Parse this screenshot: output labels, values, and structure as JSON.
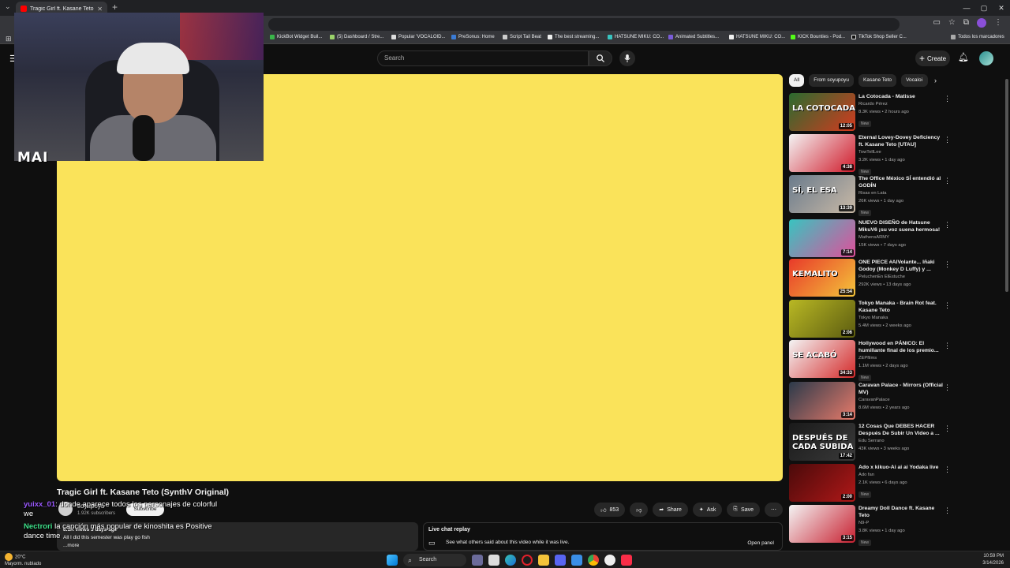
{
  "browser": {
    "tab_title": "Tragic Girl ft. Kasane Teto (SynthV",
    "bookmarks": [
      "KickBot Widget Buil...",
      "(5) Dashboard / Stre...",
      "Popular 'VOCALOID...",
      "PreSonus: Home",
      "Script Tail Beat",
      "The best streaming...",
      "HATSUNE MIKU: CO...",
      "Animated Subtitles...",
      "HATSUNE MIKU: CO...",
      "KICK Bounties - Pod...",
      "TikTok Shop Seller C..."
    ],
    "all_bookmarks": "Todos los marcadores"
  },
  "header": {
    "search_placeholder": "Search",
    "create_label": "Create"
  },
  "webcam": {
    "label": "MAI"
  },
  "video": {
    "title": "Tragic Girl ft. Kasane Teto (SynthV Original)",
    "channel": "soyupoyu",
    "subscribers": "1.92K subscribers",
    "subscribe_label": "Subscribe",
    "likes": "853",
    "share_label": "Share",
    "ask_label": "Ask",
    "save_label": "Save",
    "description_meta": "8.1K views  3 days ago",
    "description_line": "All I did this semester was play go fish",
    "more_label": "...more"
  },
  "live_chat": {
    "title": "Live chat replay",
    "subtitle": "See what others said about this video while it was live.",
    "open_panel": "Open panel"
  },
  "chat_overlay": [
    {
      "user": "yuixx_01",
      "message": ": donde aparece todos los personajes de colorful",
      "cont": "we"
    },
    {
      "user": "Nectrori",
      "message": "  la canción más popular de kinoshita es Positive",
      "cont": "dance time"
    }
  ],
  "chips": [
    "All",
    "From soyupoyu",
    "Kasane Teto",
    "Vocaloi"
  ],
  "recommendations": [
    {
      "title": "La Cotocada - Matisse",
      "channel": "Ricardo Pérez",
      "stats": "8.3K views • 2 hours ago",
      "badge": "New",
      "duration": "12:05",
      "thumb_text": "LA COTOCADA",
      "colors": [
        "#2a6b2f",
        "#d43a1f"
      ]
    },
    {
      "title": "Eternal Lovey-Dovey Deficiency ft. Kasane Teto [UTAU]",
      "channel": "TowTellLee",
      "stats": "3.2K views • 1 day ago",
      "badge": "New",
      "duration": "4:38",
      "thumb_text": "",
      "colors": [
        "#f4f4f4",
        "#d01a2a"
      ]
    },
    {
      "title": "The Office México SÍ entendió al GODÍN",
      "channel": "Risas en Lata",
      "stats": "26K views • 1 day ago",
      "badge": "New",
      "duration": "13:39",
      "thumb_text": "SÍ, EL ESA",
      "colors": [
        "#6a7b8c",
        "#c9b9a6"
      ]
    },
    {
      "title": "NUEVO DISEÑO de Hatsune MikuV6 ¡su voz suena hermosa!",
      "channel": "MathensARMY",
      "stats": "15K views • 7 days ago",
      "badge": "",
      "duration": "7:14",
      "thumb_text": "",
      "colors": [
        "#38c4c0",
        "#e04f9b"
      ]
    },
    {
      "title": "ONE PIECE #AlVolante... Iñaki Godoy (Monkey D Luffy) y ...",
      "channel": "PeluchenEn ElEstuche",
      "stats": "292K views • 13 days ago",
      "badge": "",
      "duration": "25:54",
      "thumb_text": "KEMALITO",
      "colors": [
        "#e83a2a",
        "#f4c43a"
      ]
    },
    {
      "title": "Tokyo Manaka - Brain Rot feat. Kasane Teto",
      "channel": "Tokyo Manaka",
      "stats": "5.4M views • 2 weeks ago",
      "badge": "",
      "duration": "2:06",
      "thumb_text": "",
      "colors": [
        "#b9b824",
        "#5c5c10"
      ]
    },
    {
      "title": "Hollywood en PÁNICO: El humillante final de los premio...",
      "channel": "ZEPfilms",
      "stats": "1.1M views • 2 days ago",
      "badge": "New",
      "duration": "34:33",
      "thumb_text": "SE ACABÓ",
      "colors": [
        "#f4f4f4",
        "#d42a2a"
      ]
    },
    {
      "title": "Caravan Palace - Mirrors (Official MV)",
      "channel": "CaravanPalace",
      "stats": "8.6M views • 2 years ago",
      "badge": "",
      "duration": "3:14",
      "thumb_text": "",
      "colors": [
        "#2b3a4a",
        "#e87a6a"
      ]
    },
    {
      "title": "12 Cosas Que DEBES HACER Después De Subir Un Video a ...",
      "channel": "Edu Serrano",
      "stats": "43K views • 3 weeks ago",
      "badge": "",
      "duration": "17:42",
      "thumb_text": "DESPUÉS DE CADA SUBIDA",
      "colors": [
        "#1a1a1a",
        "#3a3a3a"
      ]
    },
    {
      "title": "Ado x kikuo-Ai ai ai Yodaka live",
      "channel": "Ado fan",
      "stats": "2.1K views • 6 days ago",
      "badge": "New",
      "duration": "2:00",
      "thumb_text": "",
      "colors": [
        "#4a0a0a",
        "#b01818"
      ]
    },
    {
      "title": "Dreamy Doll Dance ft. Kasane Teto",
      "channel": "N9-P",
      "stats": "3.8K views • 1 day ago",
      "badge": "New",
      "duration": "3:15",
      "thumb_text": "",
      "colors": [
        "#f4f4f4",
        "#c82030"
      ]
    }
  ],
  "taskbar": {
    "temp": "20°C",
    "weather": "Mayorm. nublado",
    "search_label": "Search",
    "time": "10:59 PM",
    "date": "3/14/2026"
  }
}
